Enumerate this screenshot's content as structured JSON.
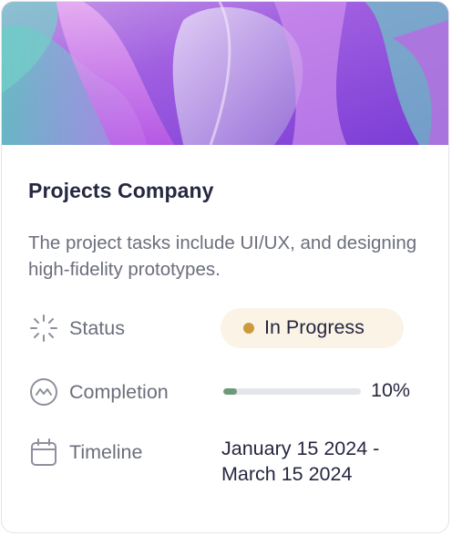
{
  "card": {
    "title": "Projects Company",
    "description": "The project tasks include UI/UX, and designing high-fidelity prototypes."
  },
  "rows": {
    "status": {
      "icon": "loader-icon",
      "label": "Status",
      "value": "In Progress",
      "dot_color": "#cd9a3a",
      "badge_color": "#fbf4e6"
    },
    "completion": {
      "icon": "gauge-icon",
      "label": "Completion",
      "percent": 10,
      "percent_text": "10%",
      "bar_color": "#6c9a78"
    },
    "timeline": {
      "icon": "calendar-icon",
      "label": "Timeline",
      "start": "January 15 2024 -",
      "end": "March 15 2024"
    }
  },
  "colors": {
    "title": "#262741",
    "muted": "#6b6e7c",
    "border": "#e3e4ea"
  }
}
